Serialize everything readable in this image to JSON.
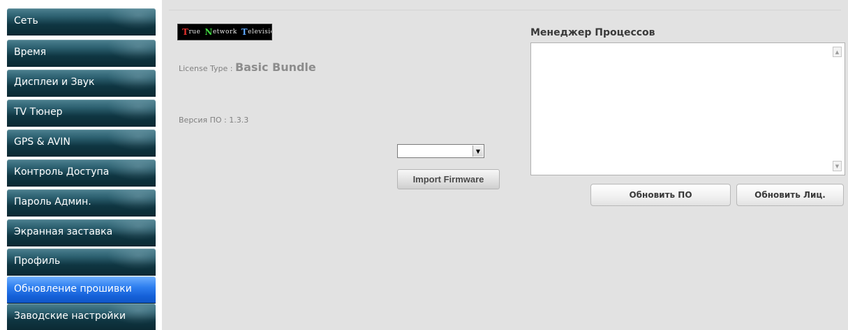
{
  "sidebar": {
    "items": [
      {
        "label": "Сеть"
      },
      {
        "label": "Время"
      },
      {
        "label": "Дисплеи и Звук"
      },
      {
        "label": "TV Тюнер"
      },
      {
        "label": "GPS & AVIN"
      },
      {
        "label": "Контроль Доступа"
      },
      {
        "label": "Пароль Админ."
      },
      {
        "label": "Экранная заставка"
      },
      {
        "label": "Профиль"
      },
      {
        "label": "Обновление прошивки"
      },
      {
        "label": "Заводские настройки"
      }
    ],
    "active_index": 9
  },
  "logo": {
    "t": "T",
    "rue": "rue",
    "n": "N",
    "etwork": "etwork",
    "tv": "T",
    "elevision": "elevision"
  },
  "license": {
    "label": "License Type :",
    "value": "Basic Bundle"
  },
  "firmware": {
    "version_text": "Версия ПО : 1.3.3"
  },
  "firmware_select": {
    "selected": ""
  },
  "import_button": {
    "label": "Import Firmware"
  },
  "process_manager": {
    "title": "Менеджер Процессов",
    "content": ""
  },
  "buttons": {
    "update_fw": "Обновить ПО",
    "update_license": "Обновить Лиц."
  },
  "colors": {
    "active_nav": "#1560d8",
    "nav": "#0f3642",
    "panel_bg": "#e2e2e2"
  }
}
